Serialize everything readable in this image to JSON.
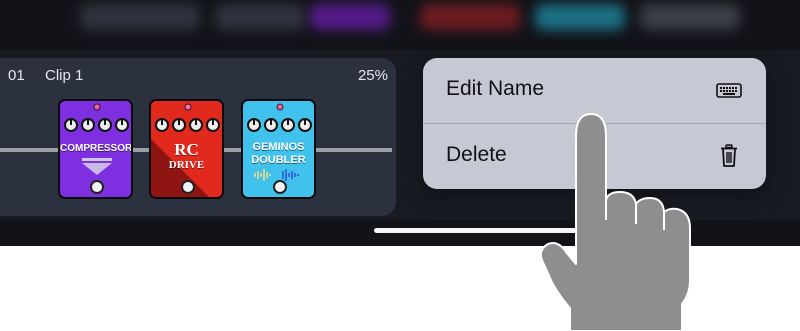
{
  "clip": {
    "index": "01",
    "name": "Clip 1",
    "percent": "25%"
  },
  "pedals": [
    {
      "name": "compressor",
      "label_lines": [
        "COMPRESSOR"
      ],
      "color": "#7e2fe0"
    },
    {
      "name": "rc-drive",
      "label_lines": [
        "RC",
        "DRIVE"
      ],
      "color": "#e1291e"
    },
    {
      "name": "geminos-doubler",
      "label_lines": [
        "GEMINOS",
        "DOUBLER"
      ],
      "color": "#41c2ec"
    }
  ],
  "context_menu": {
    "edit_name_label": "Edit Name",
    "edit_name_icon": "keyboard-icon",
    "delete_label": "Delete",
    "delete_icon": "trash-icon"
  },
  "colors": {
    "background": "#121319",
    "clip_card": "#2c3140",
    "menu_background": "#d4d6e2",
    "hand": "#8e8e8e"
  }
}
